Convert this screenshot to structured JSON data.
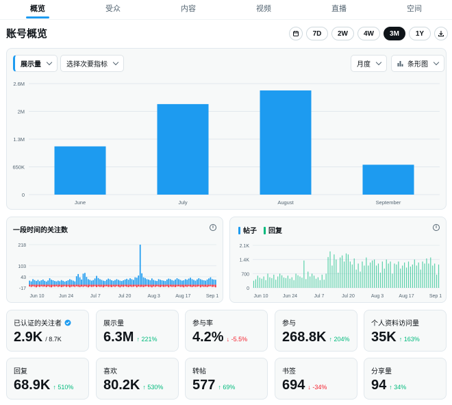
{
  "nav": {
    "tabs": [
      {
        "label": "概览",
        "active": true
      },
      {
        "label": "受众",
        "active": false
      },
      {
        "label": "内容",
        "active": false
      },
      {
        "label": "视频",
        "active": false
      },
      {
        "label": "直播",
        "active": false
      },
      {
        "label": "空间",
        "active": false
      }
    ]
  },
  "page": {
    "title": "账号概览"
  },
  "ranges": {
    "options": [
      "7D",
      "2W",
      "4W",
      "3M",
      "1Y"
    ],
    "selected": "3M",
    "calendar_icon": "calendar-icon",
    "download_icon": "download-icon"
  },
  "main_chart": {
    "metric_dropdown": "展示量",
    "secondary_dropdown": "选择次要指标",
    "period_dropdown": "月度",
    "chart_type_dropdown": "条形图"
  },
  "followers_card": {
    "title": "一段时间的关注数"
  },
  "posts_card": {
    "legend": [
      {
        "label": "帖子",
        "color": "#1d9bf0"
      },
      {
        "label": "回复",
        "color": "#00ba7c"
      }
    ]
  },
  "metrics": [
    {
      "label": "已认证的关注者",
      "value": "2.9K",
      "extra": "/ 8.7K",
      "change": "",
      "direction": "none",
      "verified": true
    },
    {
      "label": "展示量",
      "value": "6.3M",
      "extra": "",
      "change": "221%",
      "direction": "up"
    },
    {
      "label": "参与率",
      "value": "4.2%",
      "extra": "",
      "change": "-5.5%",
      "direction": "down"
    },
    {
      "label": "参与",
      "value": "268.8K",
      "extra": "",
      "change": "204%",
      "direction": "up"
    },
    {
      "label": "个人资料访问量",
      "value": "35K",
      "extra": "",
      "change": "163%",
      "direction": "up"
    },
    {
      "label": "回复",
      "value": "68.9K",
      "extra": "",
      "change": "510%",
      "direction": "up"
    },
    {
      "label": "喜欢",
      "value": "80.2K",
      "extra": "",
      "change": "530%",
      "direction": "up"
    },
    {
      "label": "转帖",
      "value": "577",
      "extra": "",
      "change": "69%",
      "direction": "up"
    },
    {
      "label": "书签",
      "value": "694",
      "extra": "",
      "change": "-34%",
      "direction": "down"
    },
    {
      "label": "分享量",
      "value": "94",
      "extra": "",
      "change": "34%",
      "direction": "up"
    }
  ],
  "chart_data": [
    {
      "type": "bar",
      "categories": [
        "June",
        "July",
        "August",
        "September"
      ],
      "values": [
        1130000,
        2120000,
        2440000,
        700000
      ],
      "ylim": [
        0,
        2600000
      ],
      "yticks": [
        "0",
        "650K",
        "1.3M",
        "2M",
        "2.6M"
      ],
      "ytick_values": [
        0,
        650000,
        1300000,
        1950000,
        2600000
      ],
      "color": "#1d9bf0",
      "grid": true
    },
    {
      "type": "bar",
      "title": "一段时间的关注数",
      "series": [
        {
          "name": "gains",
          "color": "#1d9bf0",
          "values": [
            22,
            18,
            30,
            25,
            20,
            26,
            19,
            24,
            28,
            21,
            17,
            23,
            35,
            27,
            24,
            20,
            18,
            22,
            19,
            25,
            21,
            17,
            20,
            24,
            30,
            26,
            22,
            18,
            46,
            58,
            40,
            28,
            60,
            64,
            42,
            30,
            26,
            22,
            25,
            34,
            48,
            36,
            30,
            26,
            22,
            20,
            27,
            33,
            29,
            24,
            21,
            25,
            30,
            26,
            22,
            20,
            24,
            28,
            32,
            27,
            35,
            30,
            26,
            40,
            38,
            50,
            218,
            62,
            40,
            36,
            30,
            28,
            24,
            34,
            26,
            22,
            20,
            30,
            27,
            24,
            22,
            20,
            28,
            33,
            30,
            25,
            22,
            28,
            35,
            30,
            26,
            22,
            24,
            30,
            27,
            33,
            38,
            30,
            26,
            22,
            29,
            35,
            30,
            26,
            24,
            22,
            28,
            34,
            40,
            30,
            28,
            27
          ]
        },
        {
          "name": "losses",
          "color": "#f4212e",
          "values": [
            -10,
            -12,
            -9,
            -11,
            -14,
            -10,
            -12,
            -9,
            -11,
            -10,
            -13,
            -9,
            -12,
            -14,
            -10,
            -11,
            -9,
            -12,
            -10,
            -13,
            -11,
            -9,
            -12,
            -10,
            -14,
            -11,
            -10,
            -12,
            -9,
            -11,
            -13,
            -10,
            -12,
            -9,
            -11,
            -14,
            -10,
            -12,
            -11,
            -9,
            -13,
            -10,
            -12,
            -11,
            -14,
            -10,
            -9,
            -12,
            -11,
            -13,
            -10,
            -12,
            -9,
            -11,
            -14,
            -10,
            -12,
            -9,
            -11,
            -13,
            -10,
            -12,
            -11,
            -9,
            -14,
            -10,
            -12,
            -11,
            -13,
            -10,
            -9,
            -12,
            -11,
            -14,
            -10,
            -12,
            -9,
            -11,
            -13,
            -10,
            -12,
            -11,
            -9,
            -14,
            -10,
            -12,
            -11,
            -13,
            -10,
            -9,
            -12,
            -11,
            -14,
            -10,
            -12,
            -9,
            -11,
            -13,
            -10,
            -12,
            -11,
            -9,
            -14,
            -10,
            -12,
            -11,
            -13,
            -10,
            -9,
            -12,
            -11,
            -14
          ]
        }
      ],
      "x_ticks": [
        "Jun 10",
        "Jun 24",
        "Jul 7",
        "Jul 20",
        "Aug 3",
        "Aug 17",
        "Sep 1"
      ],
      "ylim": [
        -17,
        218
      ],
      "yticks": [
        -17,
        43,
        103,
        218
      ],
      "grid": true
    },
    {
      "type": "bar",
      "series": [
        {
          "name": "帖子",
          "color": "#1d9bf0",
          "values": [
            0,
            0,
            0,
            0,
            0,
            0,
            0,
            0,
            0,
            0,
            0,
            0,
            0,
            0,
            0,
            0,
            0,
            0,
            0,
            0,
            0,
            0,
            0,
            0,
            0,
            0,
            0,
            0,
            0,
            0,
            0,
            0,
            0,
            0,
            0,
            0,
            0,
            0,
            0,
            0,
            0,
            0,
            0,
            0,
            0,
            0,
            0,
            0,
            0,
            0,
            0,
            0,
            0,
            0,
            0,
            0,
            0,
            0,
            0,
            0,
            0,
            0,
            0,
            0,
            0,
            0,
            0,
            0,
            0,
            0,
            0,
            0,
            0,
            0,
            0,
            0,
            0,
            0,
            0,
            0,
            0,
            0,
            0,
            0,
            0,
            0,
            0,
            0,
            0,
            0,
            0,
            0,
            0
          ]
        },
        {
          "name": "回复",
          "color": "#00ba7c",
          "values": [
            350,
            420,
            600,
            500,
            450,
            560,
            380,
            700,
            520,
            480,
            650,
            400,
            560,
            700,
            620,
            510,
            480,
            600,
            450,
            520,
            380,
            700,
            620,
            560,
            500,
            1350,
            430,
            800,
            560,
            700,
            600,
            450,
            520,
            380,
            650,
            400,
            700,
            1520,
            1800,
            1100,
            1650,
            1400,
            750,
            1500,
            1600,
            1300,
            1700,
            1650,
            1300,
            1150,
            1450,
            900,
            1200,
            800,
            1300,
            1100,
            1500,
            1100,
            1250,
            1350,
            1400,
            1100,
            1200,
            750,
            1300,
            950,
            1400,
            1200,
            1300,
            700,
            1200,
            1150,
            1300,
            950,
            1100,
            1250,
            1000,
            1300,
            1050,
            1150,
            1400,
            1100,
            1250,
            900,
            1300,
            1200,
            1450,
            1200,
            1500,
            1100,
            1200,
            650,
            1150
          ]
        }
      ],
      "x_ticks": [
        "Jun 10",
        "Jun 24",
        "Jul 7",
        "Jul 20",
        "Aug 3",
        "Aug 17",
        "Sep 1"
      ],
      "ylim": [
        0,
        2100
      ],
      "yticks": [
        "0",
        "700",
        "1.4K",
        "2.1K"
      ],
      "ytick_values": [
        0,
        700,
        1400,
        2100
      ],
      "grid": true
    }
  ]
}
